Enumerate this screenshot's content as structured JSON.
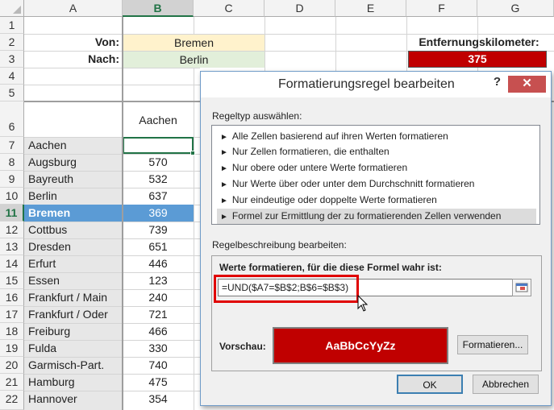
{
  "columns": [
    "A",
    "B",
    "C",
    "D",
    "E",
    "F",
    "G"
  ],
  "selected_column": "B",
  "rows": [
    "1",
    "2",
    "3",
    "4",
    "5",
    "6",
    "7",
    "8",
    "9",
    "10",
    "11",
    "12",
    "13",
    "14",
    "15",
    "16",
    "17",
    "18",
    "19",
    "20",
    "21",
    "22"
  ],
  "selected_row": "11",
  "von": {
    "label": "Von:",
    "value": "Bremen"
  },
  "nach": {
    "label": "Nach:",
    "value": "Berlin"
  },
  "distance": {
    "label": "Entfernungskilometer:",
    "value": "375"
  },
  "header_b6": "Aachen",
  "table": [
    {
      "city": "Aachen",
      "km": ""
    },
    {
      "city": "Augsburg",
      "km": "570"
    },
    {
      "city": "Bayreuth",
      "km": "532"
    },
    {
      "city": "Berlin",
      "km": "637"
    },
    {
      "city": "Bremen",
      "km": "369"
    },
    {
      "city": "Cottbus",
      "km": "739"
    },
    {
      "city": "Dresden",
      "km": "651"
    },
    {
      "city": "Erfurt",
      "km": "446"
    },
    {
      "city": "Essen",
      "km": "123"
    },
    {
      "city": "Frankfurt / Main",
      "km": "240"
    },
    {
      "city": "Frankfurt / Oder",
      "km": "721"
    },
    {
      "city": "Freiburg",
      "km": "466"
    },
    {
      "city": "Fulda",
      "km": "330"
    },
    {
      "city": "Garmisch-Part.",
      "km": "740"
    },
    {
      "city": "Hamburg",
      "km": "475"
    },
    {
      "city": "Hannover",
      "km": "354"
    }
  ],
  "dialog": {
    "title": "Formatierungsregel bearbeiten",
    "help": "?",
    "close": "✕",
    "ruletype_label": "Regeltyp auswählen:",
    "rule_types": [
      "Alle Zellen basierend auf ihren Werten formatieren",
      "Nur Zellen formatieren, die enthalten",
      "Nur obere oder untere Werte formatieren",
      "Nur Werte über oder unter dem Durchschnitt formatieren",
      "Nur eindeutige oder doppelte Werte formatieren",
      "Formel zur Ermittlung der zu formatierenden Zellen verwenden"
    ],
    "selected_rule_index": 5,
    "description_label": "Regelbeschreibung bearbeiten:",
    "formula_label": "Werte formatieren, für die diese Formel wahr ist:",
    "formula": "=UND($A7=$B$2;B$6=$B$3)",
    "preview_label": "Vorschau:",
    "preview_text": "AaBbCcYyZz",
    "format_button": "Formatieren...",
    "ok_button": "OK",
    "cancel_button": "Abbrechen"
  },
  "colors": {
    "excel_green": "#217346",
    "highlight_red": "#c00000",
    "selected_row_blue": "#5b9bd5",
    "von_fill": "#fff2cc",
    "nach_fill": "#e2efda"
  }
}
